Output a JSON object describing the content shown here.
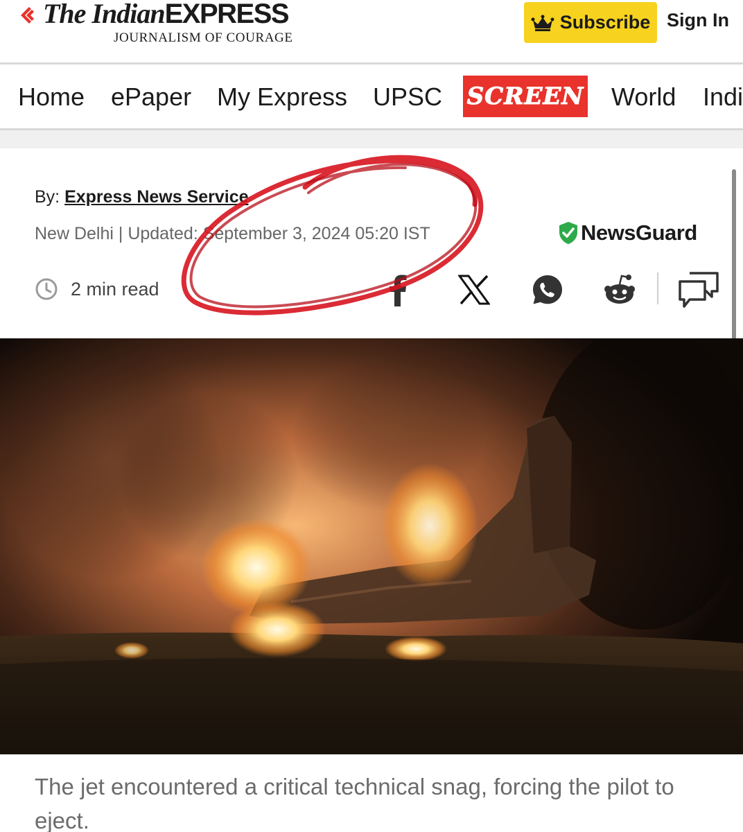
{
  "header": {
    "brand_the": "The Indian",
    "brand_express": "EXPRESS",
    "tagline": "JOURNALISM OF COURAGE",
    "subscribe_label": "Subscribe",
    "signin_label": "Sign In",
    "accent_color": "#e8322b",
    "subscribe_color": "#f7d21e"
  },
  "nav": {
    "items": [
      "Home",
      "ePaper",
      "My Express",
      "UPSC",
      "World",
      "Indi"
    ],
    "screen_label": "SCREEN"
  },
  "article": {
    "byline_prefix": "By:",
    "author": "Express News Service",
    "dateline": "New Delhi | Updated: September 3, 2024 05:20 IST",
    "read_time": "2 min read",
    "newsguard_label": "NewsGuard",
    "caption": "The jet encountered a critical technical snag, forcing the pilot to eject."
  },
  "share_icons": [
    "facebook-icon",
    "x-icon",
    "whatsapp-icon",
    "reddit-icon",
    "comments-icon"
  ],
  "hero_image": {
    "description_icon": "burning-jet-photo"
  }
}
